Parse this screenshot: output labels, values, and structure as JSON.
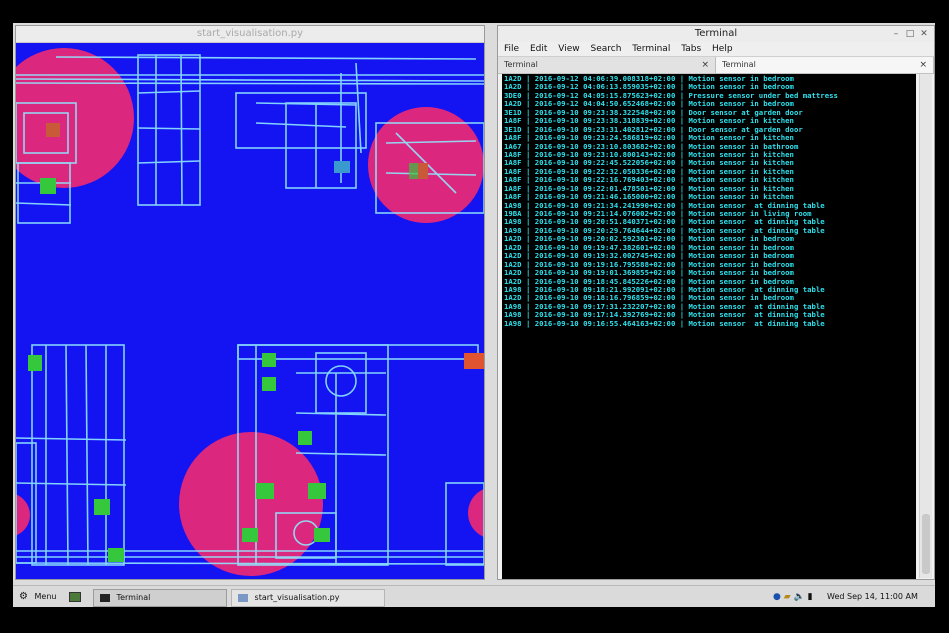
{
  "viz_window": {
    "title": "start_visualisation.py"
  },
  "terminal_window": {
    "title": "Terminal",
    "menu": [
      "File",
      "Edit",
      "View",
      "Search",
      "Terminal",
      "Tabs",
      "Help"
    ],
    "tabs": [
      {
        "label": "Terminal",
        "close": "×"
      },
      {
        "label": "Terminal",
        "close": "×"
      }
    ],
    "lines": [
      "1A2D | 2016-09-12 04:06:39.008318+02:00 | Motion sensor in bedroom",
      "1A2D | 2016-09-12 04:06:13.859035+02:00 | Motion sensor in bedroom",
      "3DE0 | 2016-09-12 04:05:15.875623+02:00 | Pressure sensor under bed mattress",
      "1A2D | 2016-09-12 04:04:50.652468+02:00 | Motion sensor in bedroom",
      "3E1D | 2016-09-10 09:23:38.322548+02:00 | Door sensor at garden door",
      "1A8F | 2016-09-10 09:23:38.318839+02:00 | Motion sensor in kitchen",
      "3E1D | 2016-09-10 09:23:31.402812+02:00 | Door sensor at garden door",
      "1A8F | 2016-09-10 09:23:24.586819+02:00 | Motion sensor in kitchen",
      "1A67 | 2016-09-10 09:23:10.803682+02:00 | Motion sensor in bathroom",
      "1A8F | 2016-09-10 09:23:10.800143+02:00 | Motion sensor in kitchen",
      "1A8F | 2016-09-10 09:22:45.522056+02:00 | Motion sensor in kitchen",
      "1A8F | 2016-09-10 09:22:32.050336+02:00 | Motion sensor in kitchen",
      "1A8F | 2016-09-10 09:22:16.769403+02:00 | Motion sensor in kitchen",
      "1A8F | 2016-09-10 09:22:01.478501+02:00 | Motion sensor in kitchen",
      "1A8F | 2016-09-10 09:21:46.165000+02:00 | Motion sensor in kitchen",
      "1A98 | 2016-09-10 09:21:34.241990+02:00 | Motion sensor  at dinning table",
      "19BA | 2016-09-10 09:21:14.076002+02:00 | Motion sensor in living room",
      "1A98 | 2016-09-10 09:20:51.840371+02:00 | Motion sensor  at dinning table",
      "1A98 | 2016-09-10 09:20:29.764644+02:00 | Motion sensor  at dinning table",
      "1A2D | 2016-09-10 09:20:02.592301+02:00 | Motion sensor in bedroom",
      "1A2D | 2016-09-10 09:19:47.382601+02:00 | Motion sensor in bedroom",
      "1A2D | 2016-09-10 09:19:32.002745+02:00 | Motion sensor in bedroom",
      "1A2D | 2016-09-10 09:19:16.795588+02:00 | Motion sensor in bedroom",
      "1A2D | 2016-09-10 09:19:01.369855+02:00 | Motion sensor in bedroom",
      "1A2D | 2016-09-10 09:18:45.845226+02:00 | Motion sensor in bedroom",
      "1A98 | 2016-09-10 09:18:21.992091+02:00 | Motion sensor  at dinning table",
      "1A2D | 2016-09-10 09:18:16.796859+02:00 | Motion sensor in bedroom",
      "1A98 | 2016-09-10 09:17:31.232207+02:00 | Motion sensor  at dinning table",
      "1A98 | 2016-09-10 09:17:14.392769+02:00 | Motion sensor  at dinning table",
      "1A98 | 2016-09-10 09:16:55.464163+02:00 | Motion sensor  at dinning table"
    ]
  },
  "taskbar": {
    "menu_label": "Menu",
    "tasks": [
      "Terminal",
      "start_visualisation.py"
    ],
    "clock": "Wed Sep 14, 11:00 AM"
  },
  "colors": {
    "canvas_bg": "#1414f2",
    "wire": "#8fe8ff",
    "sensor_zone": "#ff2a6a",
    "sensor_active": "#35c83c",
    "terminal_text": "#2ee0ec"
  },
  "icons": {
    "menu": "gear-icon",
    "task_terminal": "terminal-icon",
    "task_viz": "window-icon",
    "tray": [
      "bluetooth-icon",
      "network-icon",
      "volume-icon",
      "power-icon"
    ]
  }
}
